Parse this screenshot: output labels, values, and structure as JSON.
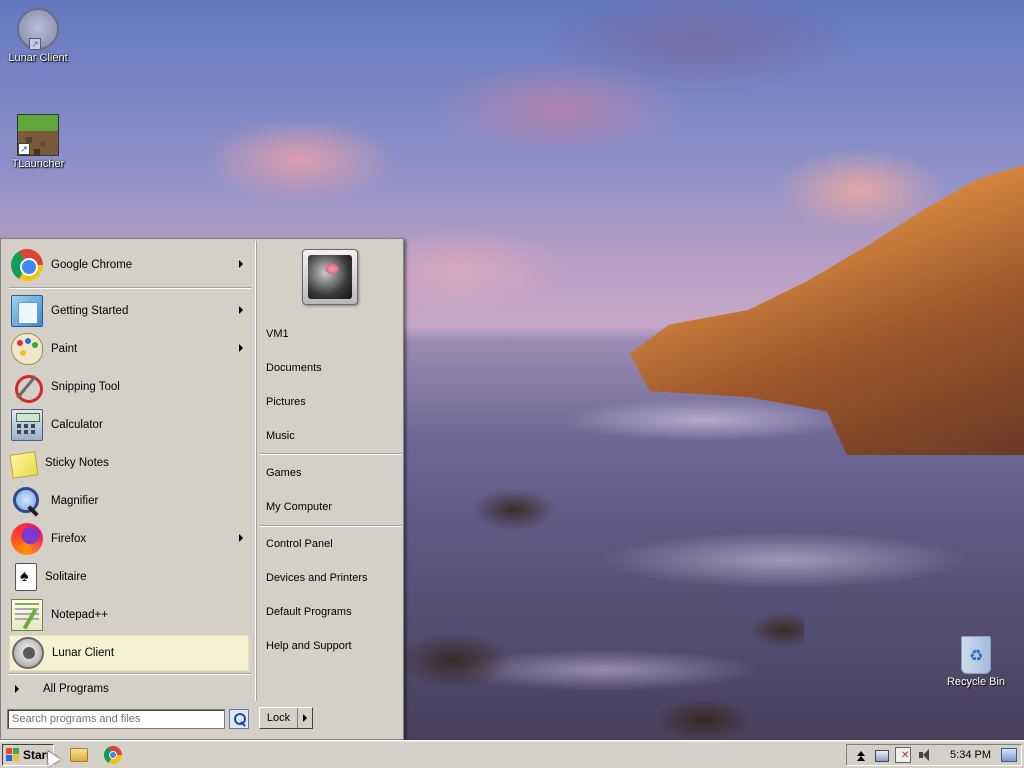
{
  "desktop": {
    "icons": [
      {
        "label": "Lunar Client",
        "icon": "lunar-client-icon"
      },
      {
        "label": "TLauncher",
        "icon": "tlauncher-icon"
      }
    ],
    "recycle_bin": {
      "label": "Recycle Bin",
      "icon": "recycle-bin-icon"
    }
  },
  "start_menu": {
    "pinned": [
      {
        "label": "Google Chrome",
        "icon": "chrome-icon",
        "submenu": true
      }
    ],
    "recent": [
      {
        "label": "Getting Started",
        "icon": "getting-started-icon",
        "submenu": true
      },
      {
        "label": "Paint",
        "icon": "paint-icon",
        "submenu": true
      },
      {
        "label": "Snipping Tool",
        "icon": "snipping-tool-icon",
        "submenu": false
      },
      {
        "label": "Calculator",
        "icon": "calculator-icon",
        "submenu": false
      },
      {
        "label": "Sticky Notes",
        "icon": "sticky-notes-icon",
        "submenu": false
      },
      {
        "label": "Magnifier",
        "icon": "magnifier-icon",
        "submenu": false
      },
      {
        "label": "Firefox",
        "icon": "firefox-icon",
        "submenu": true
      },
      {
        "label": "Solitaire",
        "icon": "solitaire-icon",
        "submenu": false
      },
      {
        "label": "Notepad++",
        "icon": "notepad-plus-plus-icon",
        "submenu": false
      },
      {
        "label": "Lunar Client",
        "icon": "lunar-client-icon",
        "submenu": false,
        "highlighted": true
      }
    ],
    "all_programs": "All Programs",
    "search": {
      "placeholder": "Search programs and files",
      "value": ""
    },
    "right": {
      "group1": [
        "VM1",
        "Documents",
        "Pictures",
        "Music"
      ],
      "group2": [
        "Games",
        "My Computer"
      ],
      "group3": [
        "Control Panel",
        "Devices and Printers",
        "Default Programs",
        "Help and Support"
      ]
    },
    "lock_button": "Lock"
  },
  "taskbar": {
    "start_label": "Start",
    "quick_launch": [
      "folder-icon",
      "chrome-icon"
    ],
    "tray_icons": [
      "show-hidden-icons",
      "network-icon",
      "action-center-icon",
      "volume-icon"
    ],
    "clock": "5:34 PM"
  },
  "colors": {
    "menu_bg": "#d4d0c8",
    "highlight": "#f5f2d2"
  }
}
